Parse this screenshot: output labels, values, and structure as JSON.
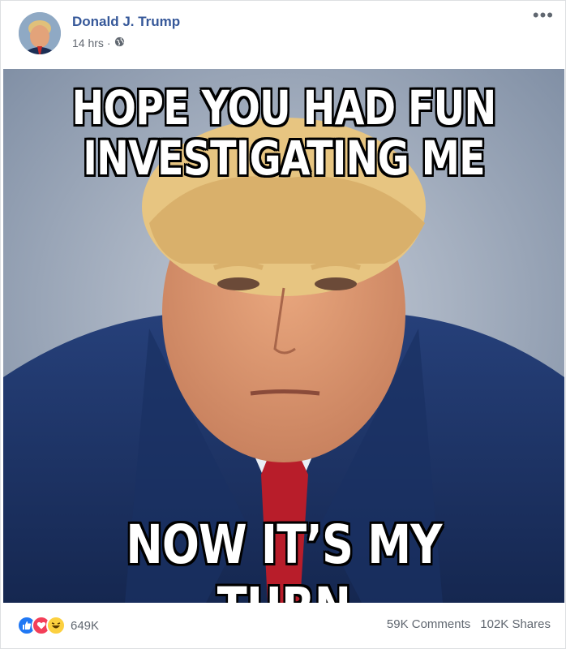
{
  "post": {
    "author": "Donald J. Trump",
    "time": "14 hrs",
    "separator": "·",
    "privacy_icon": "globe-icon",
    "more_label": "•••"
  },
  "meme": {
    "top_line1": "HOPE YOU HAD FUN",
    "top_line2": "INVESTIGATING ME",
    "bottom_line": "NOW IT’S MY TURN"
  },
  "footer": {
    "reaction_icons": [
      "like-icon",
      "love-icon",
      "haha-icon"
    ],
    "reaction_count": "649K",
    "comments": "59K Comments",
    "shares": "102K Shares"
  },
  "colors": {
    "name_blue": "#365899",
    "like_blue": "#2078f4",
    "love_red": "#f33e58",
    "haha_yellow": "#fcd03f",
    "suit_navy": "#1d3566",
    "tie_red": "#b81d2a"
  }
}
